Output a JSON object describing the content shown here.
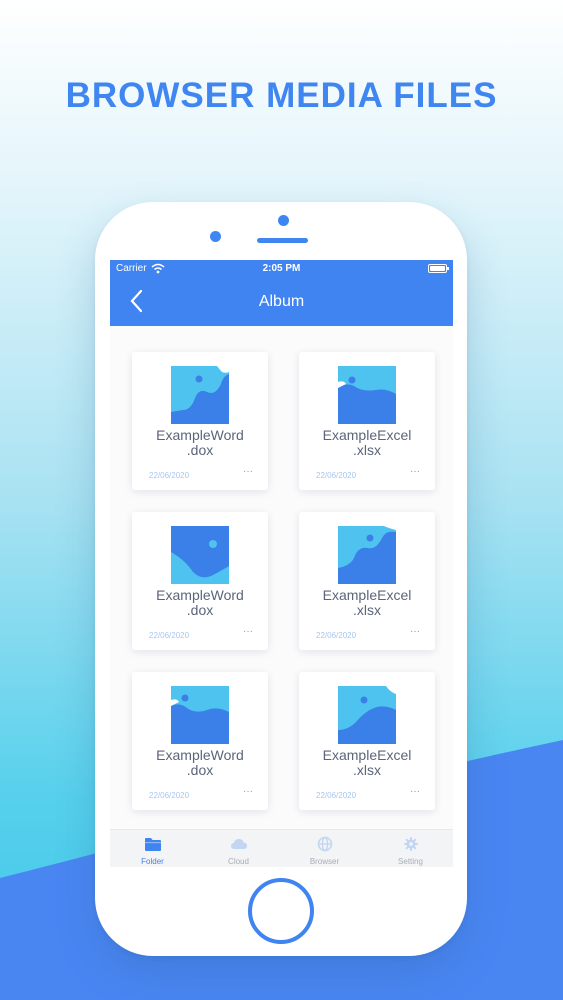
{
  "headline": "BROWSER MEDIA FILES",
  "status_bar": {
    "carrier": "Carrier",
    "time": "2:05 PM"
  },
  "nav": {
    "title": "Album",
    "back_icon": "chevron-left-icon"
  },
  "files": [
    {
      "name_line1": "ExampleWord",
      "name_line2": ".dox",
      "date": "22/06/2020",
      "more": "···",
      "thumb_icon": "image-icon"
    },
    {
      "name_line1": "ExampleExcel",
      "name_line2": ".xlsx",
      "date": "22/06/2020",
      "more": "···",
      "thumb_icon": "image-icon"
    },
    {
      "name_line1": "ExampleWord",
      "name_line2": ".dox",
      "date": "22/06/2020",
      "more": "···",
      "thumb_icon": "image-icon"
    },
    {
      "name_line1": "ExampleExcel",
      "name_line2": ".xlsx",
      "date": "22/06/2020",
      "more": "···",
      "thumb_icon": "image-icon"
    },
    {
      "name_line1": "ExampleWord",
      "name_line2": ".dox",
      "date": "22/06/2020",
      "more": "···",
      "thumb_icon": "image-icon"
    },
    {
      "name_line1": "ExampleExcel",
      "name_line2": ".xlsx",
      "date": "22/06/2020",
      "more": "···",
      "thumb_icon": "image-icon"
    }
  ],
  "tabs": [
    {
      "label": "Folder",
      "icon": "folder-icon",
      "active": true
    },
    {
      "label": "Cloud",
      "icon": "cloud-icon",
      "active": false
    },
    {
      "label": "Browser",
      "icon": "globe-icon",
      "active": false
    },
    {
      "label": "Setting",
      "icon": "gear-icon",
      "active": false
    }
  ],
  "colors": {
    "accent": "#3f84f0",
    "headline": "#3f86f0",
    "thumb_sky": "#4fc3f0",
    "thumb_blue": "#3b7fe8"
  }
}
